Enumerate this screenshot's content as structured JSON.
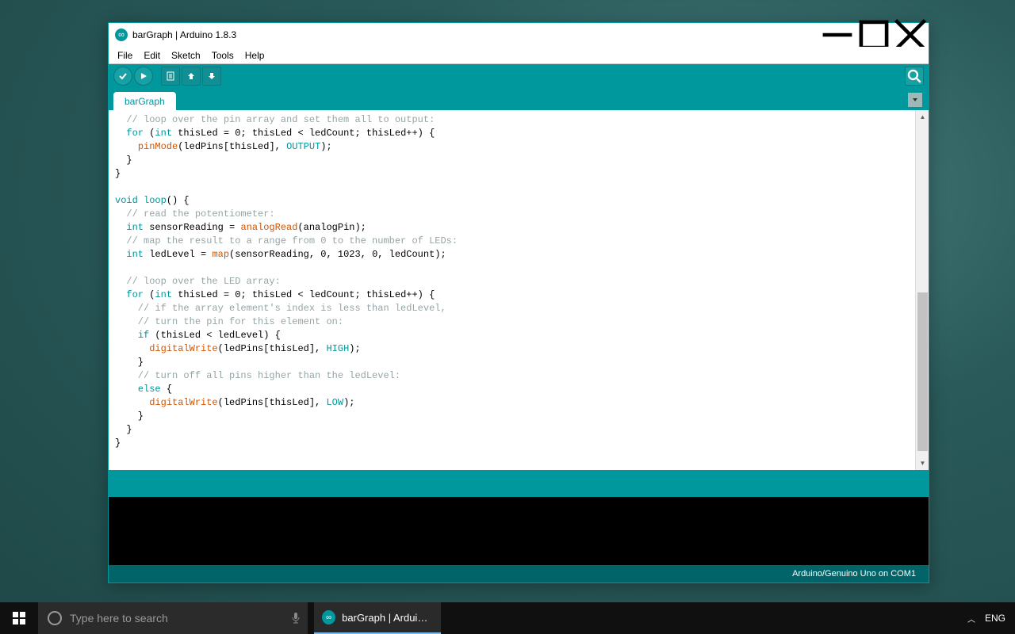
{
  "window": {
    "title": "barGraph | Arduino 1.8.3"
  },
  "menu": {
    "file": "File",
    "edit": "Edit",
    "sketch": "Sketch",
    "tools": "Tools",
    "help": "Help"
  },
  "tabs": {
    "active": "barGraph"
  },
  "code": {
    "l1_cm": "  // loop over the pin array and set them all to output:",
    "l2a": "  ",
    "l2_for": "for",
    "l2b": " (",
    "l2_int": "int",
    "l2c": " thisLed = 0; thisLed < ledCount; thisLed++) {",
    "l3a": "    ",
    "l3_fn": "pinMode",
    "l3b": "(ledPins[thisLed], ",
    "l3_cn": "OUTPUT",
    "l3c": ");",
    "l4": "  }",
    "l5": "}",
    "l6": "",
    "l7a": "",
    "l7_void": "void",
    "l7b": " ",
    "l7_loop": "loop",
    "l7c": "() {",
    "l8_cm": "  // read the potentiometer:",
    "l9a": "  ",
    "l9_int": "int",
    "l9b": " sensorReading = ",
    "l9_fn": "analogRead",
    "l9c": "(analogPin);",
    "l10_cm": "  // map the result to a range from 0 to the number of LEDs:",
    "l11a": "  ",
    "l11_int": "int",
    "l11b": " ledLevel = ",
    "l11_fn": "map",
    "l11c": "(sensorReading, 0, 1023, 0, ledCount);",
    "l12": "",
    "l13_cm": "  // loop over the LED array:",
    "l14a": "  ",
    "l14_for": "for",
    "l14b": " (",
    "l14_int": "int",
    "l14c": " thisLed = 0; thisLed < ledCount; thisLed++) {",
    "l15_cm": "    // if the array element's index is less than ledLevel,",
    "l16_cm": "    // turn the pin for this element on:",
    "l17a": "    ",
    "l17_if": "if",
    "l17b": " (thisLed < ledLevel) {",
    "l18a": "      ",
    "l18_fn": "digitalWrite",
    "l18b": "(ledPins[thisLed], ",
    "l18_cn": "HIGH",
    "l18c": ");",
    "l19": "    }",
    "l20_cm": "    // turn off all pins higher than the ledLevel:",
    "l21a": "    ",
    "l21_else": "else",
    "l21b": " {",
    "l22a": "      ",
    "l22_fn": "digitalWrite",
    "l22b": "(ledPins[thisLed], ",
    "l22_cn": "LOW",
    "l22c": ");",
    "l23": "    }",
    "l24": "  }",
    "l25": "}"
  },
  "footer": {
    "board": "Arduino/Genuino Uno on COM1"
  },
  "taskbar": {
    "search_placeholder": "Type here to search",
    "app": "barGraph | Arduino...",
    "lang": "ENG"
  }
}
